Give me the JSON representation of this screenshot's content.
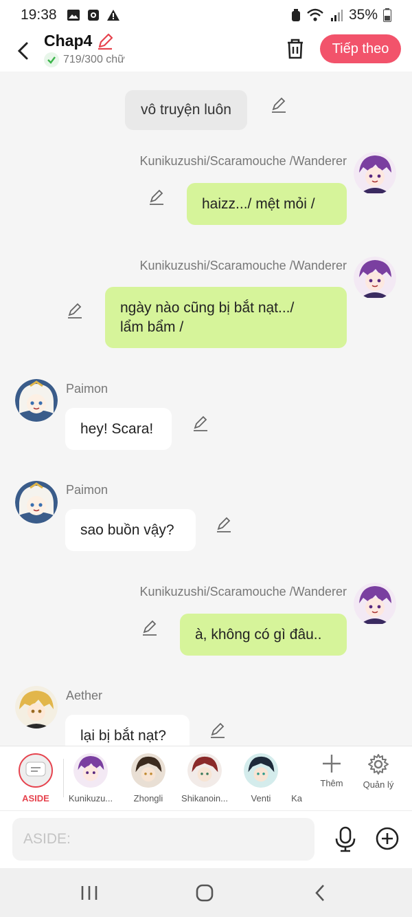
{
  "status_bar": {
    "time": "19:38",
    "battery": "35%"
  },
  "header": {
    "title": "Chap4",
    "word_count": "719/300 chữ",
    "next_label": "Tiếp theo"
  },
  "messages": [
    {
      "type": "narration",
      "text": "vô truyện luôn"
    },
    {
      "type": "right",
      "name": "Kunikuzushi/Scaramouche /Wanderer",
      "lines": [
        "haizz.../ mệt mỏi /"
      ]
    },
    {
      "type": "right",
      "name": "Kunikuzushi/Scaramouche /Wanderer",
      "lines": [
        "ngày nào cũng bị bắt nạt.../",
        "lẩm bẩm /"
      ]
    },
    {
      "type": "left",
      "name": "Paimon",
      "lines": [
        "hey! Scara!"
      ]
    },
    {
      "type": "left",
      "name": "Paimon",
      "lines": [
        "sao buồn vậy?"
      ]
    },
    {
      "type": "right",
      "name": "Kunikuzushi/Scaramouche /Wanderer",
      "lines": [
        "à, không có gì đâu.."
      ]
    },
    {
      "type": "left",
      "name": "Aether",
      "lines": [
        "lại bị bắt nạt?"
      ]
    }
  ],
  "characters": [
    {
      "label": "ASIDE"
    },
    {
      "label": "Kunikuzu..."
    },
    {
      "label": "Zhongli"
    },
    {
      "label": "Shikanoin..."
    },
    {
      "label": "Venti"
    },
    {
      "label": "Ka"
    }
  ],
  "tools": {
    "add_label": "Thêm",
    "manage_label": "Quản lý"
  },
  "input": {
    "placeholder": "ASIDE:"
  },
  "colors": {
    "accent": "#f2536b",
    "green_bubble": "#d6f49a",
    "aside_red": "#e6434e"
  }
}
